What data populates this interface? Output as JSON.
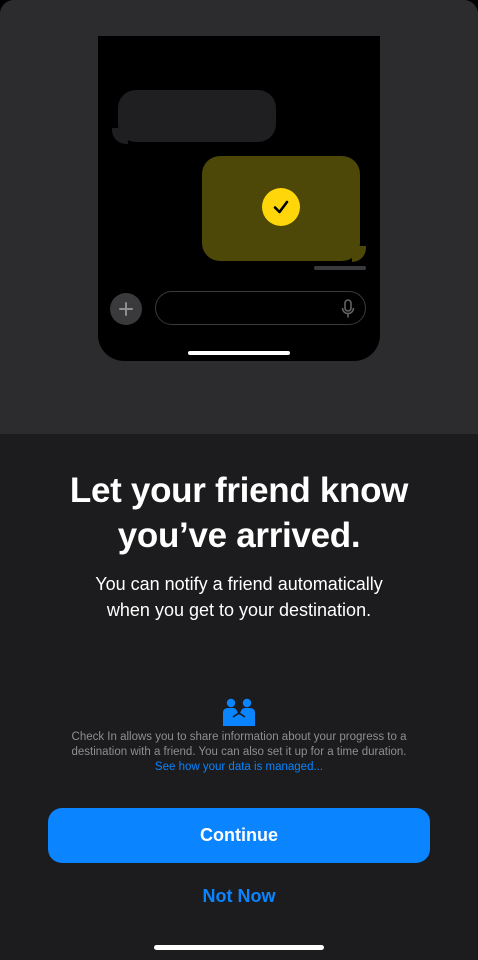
{
  "colors": {
    "accent": "#0a84ff",
    "check_yellow": "#ffd60a",
    "sheet_bg": "#1c1c1e",
    "illustration_bg": "#2c2c2e"
  },
  "illustration": {
    "icons": [
      "checkmark-icon",
      "plus-icon",
      "microphone-icon"
    ]
  },
  "headline": {
    "line1": "Let your friend know",
    "line2": "you’ve arrived."
  },
  "subtitle": {
    "line1": "You can notify a friend automatically",
    "line2": "when you get to your destination."
  },
  "privacy": {
    "icon": "privacy-handshake-icon",
    "line1": "Check In allows you to share information about your progress to a",
    "line2": "destination with a friend. You can also set it up for a time duration.",
    "link": "See how your data is managed..."
  },
  "buttons": {
    "continue": "Continue",
    "not_now": "Not Now"
  }
}
